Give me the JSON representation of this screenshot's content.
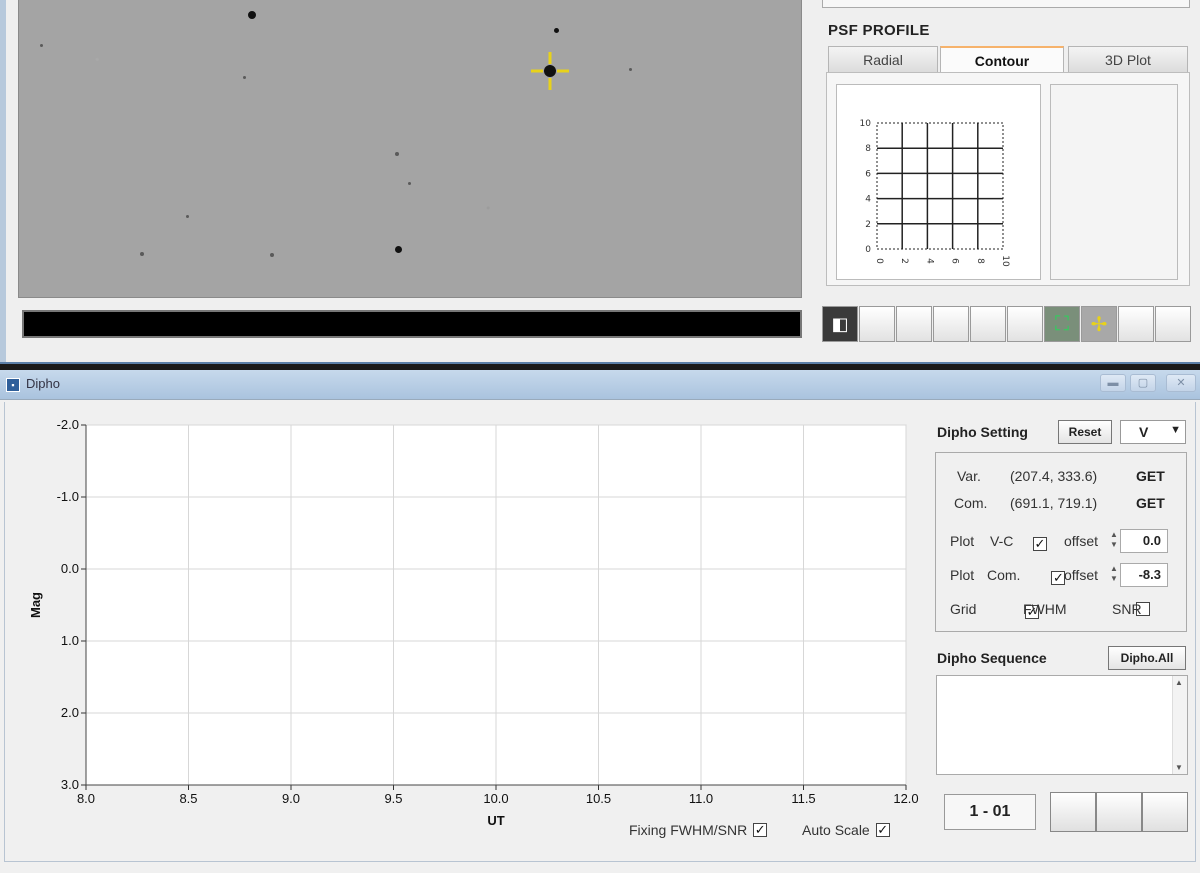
{
  "psf": {
    "title": "PSF PROFILE",
    "tabs": [
      "Radial",
      "Contour",
      "3D Plot"
    ],
    "active_tab": "Contour",
    "contour_y_ticks": [
      "10",
      "8",
      "6",
      "4",
      "2",
      "0"
    ],
    "contour_x_ticks": [
      "0",
      "2",
      "4",
      "6",
      "8",
      "10"
    ]
  },
  "window": {
    "title": "Dipho",
    "controls": [
      "minimize",
      "maximize",
      "close"
    ]
  },
  "chart_data": {
    "type": "scatter",
    "xlabel": "UT",
    "ylabel": "Mag",
    "xlim": [
      8.0,
      12.0
    ],
    "ylim": [
      3.0,
      -2.0
    ],
    "x_ticks": [
      "8.0",
      "8.5",
      "9.0",
      "9.5",
      "10.0",
      "10.5",
      "11.0",
      "11.5",
      "12.0"
    ],
    "y_ticks": [
      "-2.0",
      "-1.0",
      "0.0",
      "1.0",
      "2.0",
      "3.0"
    ],
    "grid": true,
    "series": []
  },
  "chart_options": {
    "fixing_label": "Fixing FWHM/SNR",
    "fixing_checked": true,
    "autoscale_label": "Auto Scale",
    "autoscale_checked": true
  },
  "settings": {
    "title": "Dipho Setting",
    "reset_label": "Reset",
    "band": "V",
    "var_label": "Var.",
    "var_coords": "(207.4, 333.6)",
    "com_label": "Com.",
    "com_coords": "(691.1, 719.1)",
    "get_label": "GET",
    "plot_label": "Plot",
    "vc_label": "V-C",
    "vc_checked": true,
    "offset_label": "offset",
    "vc_offset": "0.0",
    "com_plot_label": "Com.",
    "com_checked": true,
    "com_offset": "-8.3",
    "grid_label": "Grid",
    "grid_checked": true,
    "fwhm_label": "FWHM",
    "fwhm_checked": false,
    "snr_label": "SNR",
    "snr_checked": false
  },
  "sequence": {
    "title": "Dipho Sequence",
    "button_label": "Dipho.All",
    "items": []
  },
  "navigation": {
    "frame": "1 - 01"
  },
  "colors": {
    "image_background": "#a4a4a4",
    "crosshair": "#e8d21a",
    "titlebar": "#aac3de",
    "active_tab_accent": "#f6b26b"
  }
}
